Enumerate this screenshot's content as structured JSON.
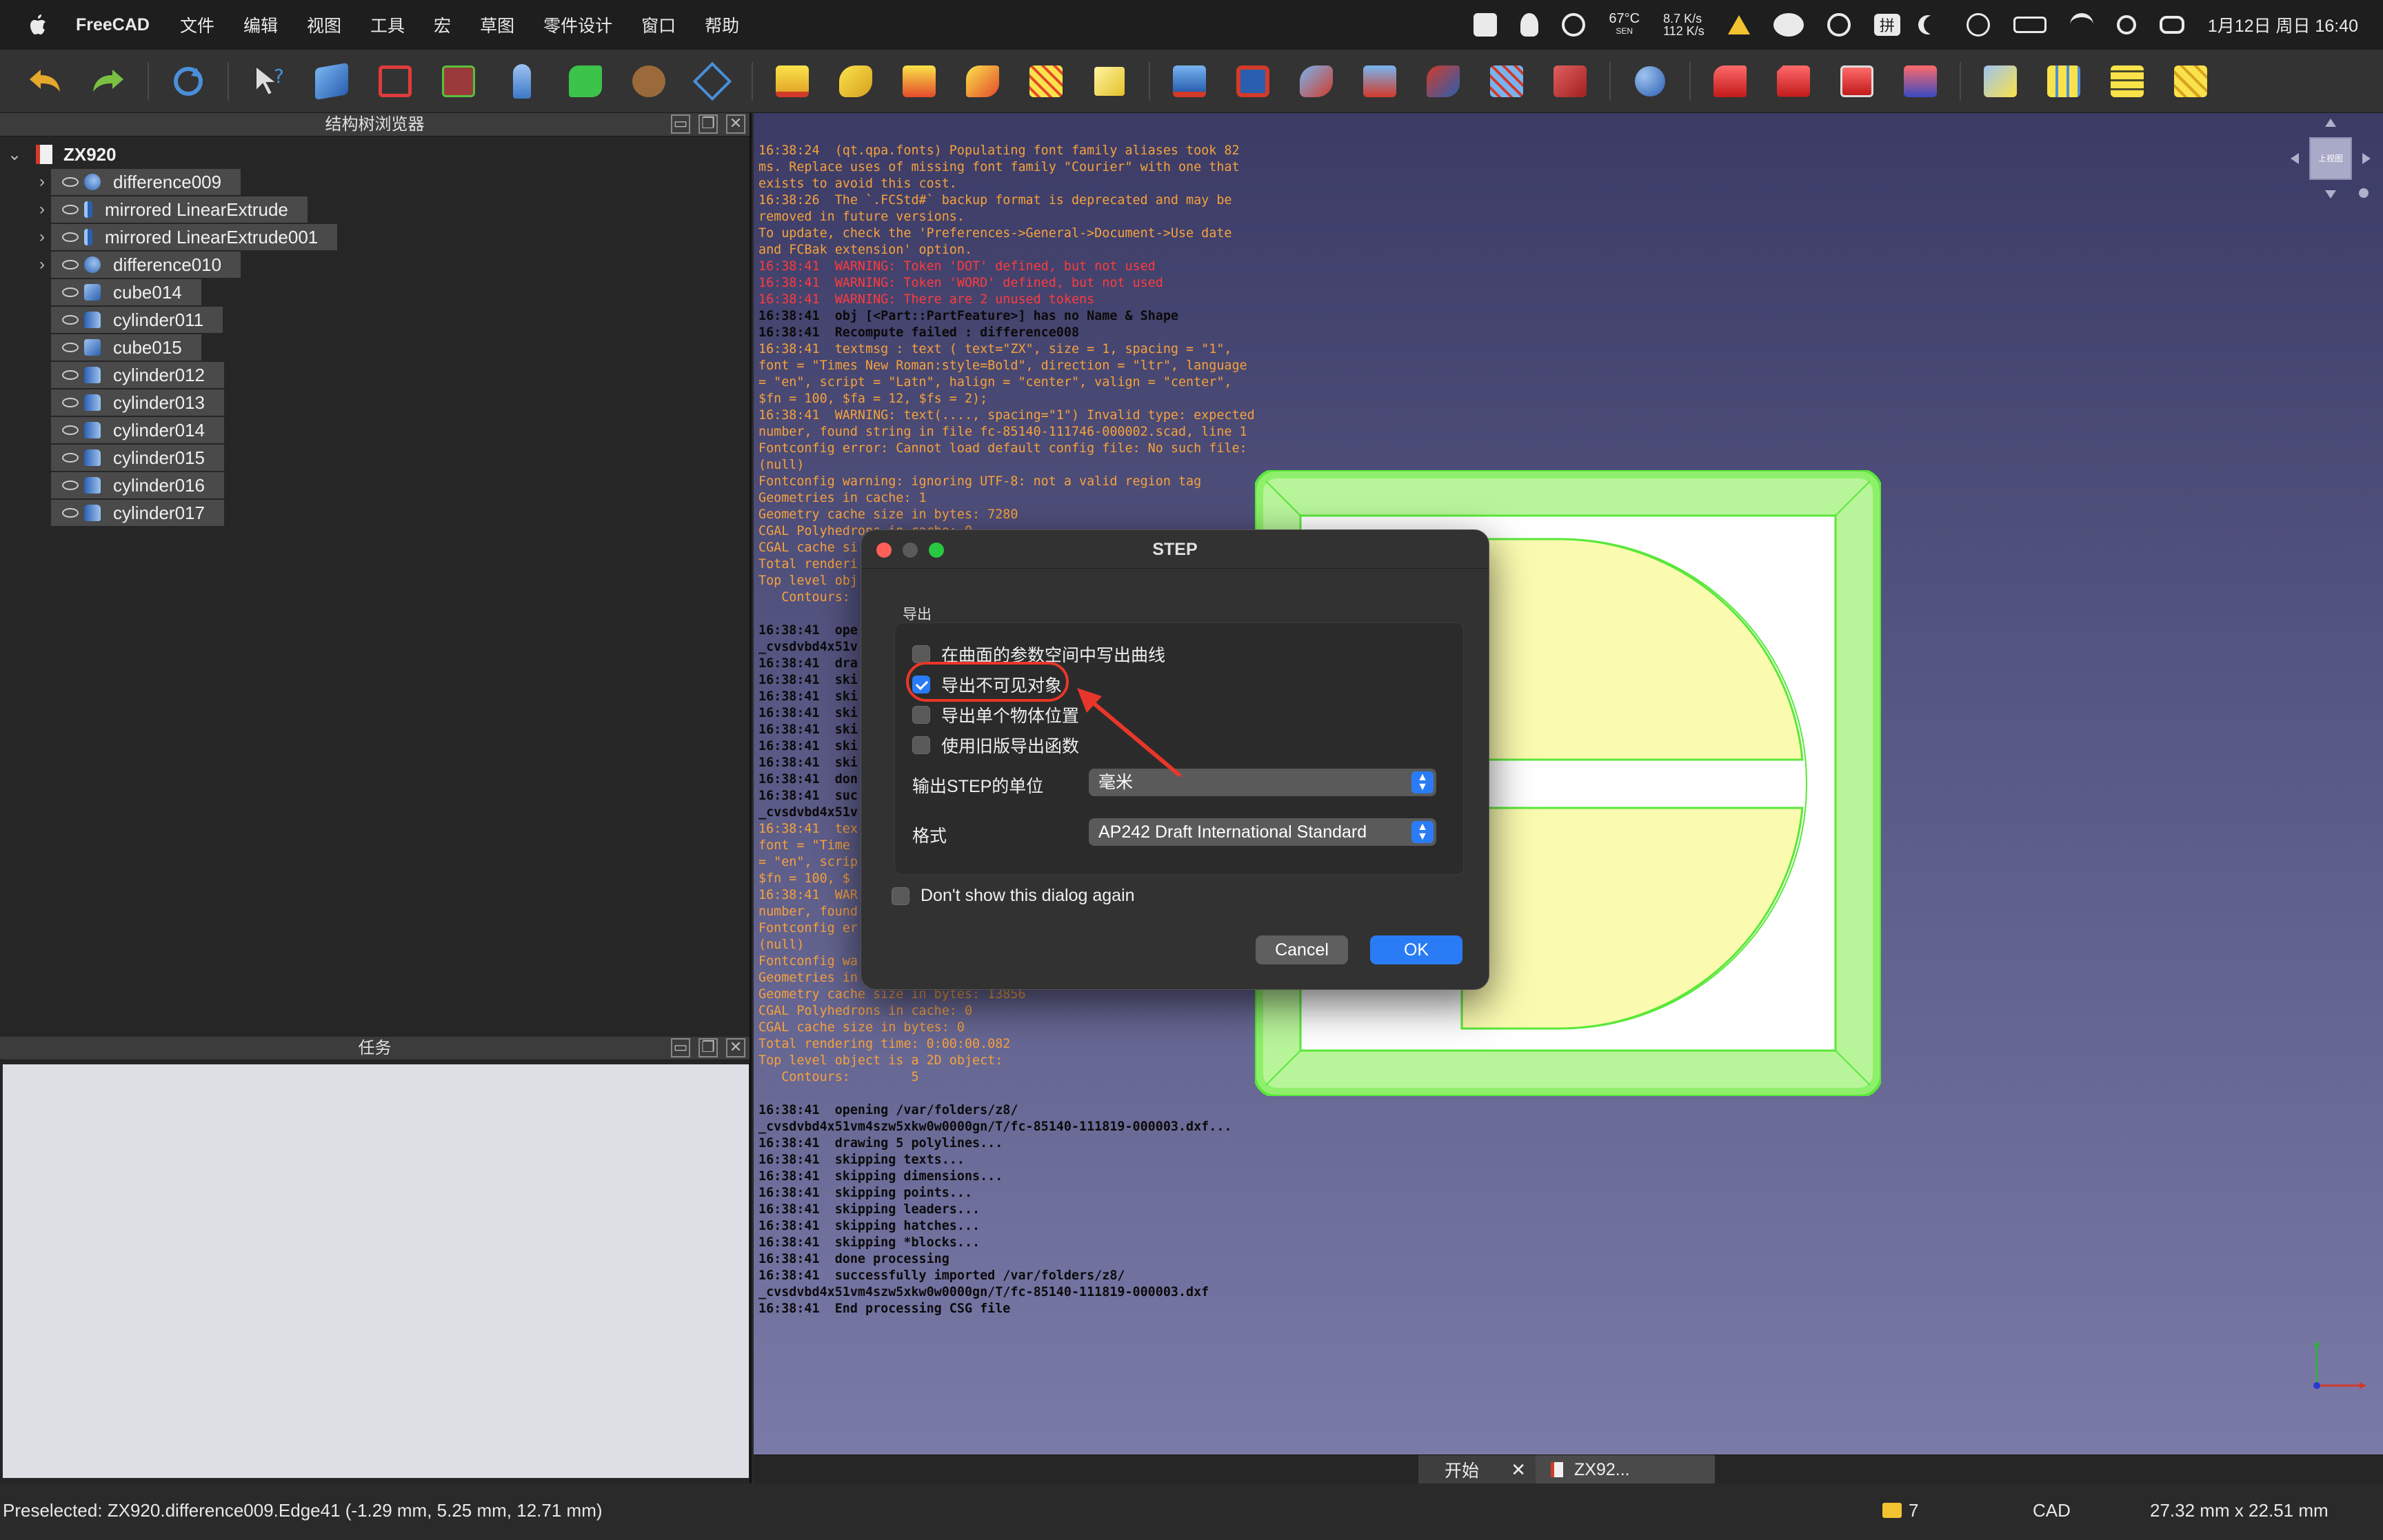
{
  "menubar": {
    "app_name": "FreeCAD",
    "menus": [
      "文件",
      "编辑",
      "视图",
      "工具",
      "宏",
      "草图",
      "零件设计",
      "窗口",
      "帮助"
    ],
    "temp": "67°C",
    "temp_sub": "SEN",
    "net_up": "8.7 K/s",
    "net_down": "112 K/s",
    "input_method": "拼",
    "datetime": "1月12日 周日 16:40"
  },
  "tree_panel": {
    "title": "结构树浏览器",
    "document": "ZX920",
    "items": [
      {
        "label": "difference009",
        "icon": "difference-icon",
        "expandable": true
      },
      {
        "label": "mirrored LinearExtrude",
        "icon": "extrude-icon",
        "expandable": true
      },
      {
        "label": "mirrored LinearExtrude001",
        "icon": "extrude-icon",
        "expandable": true
      },
      {
        "label": "difference010",
        "icon": "difference-icon",
        "expandable": true
      },
      {
        "label": "cube014",
        "icon": "cube-icon",
        "expandable": false
      },
      {
        "label": "cylinder011",
        "icon": "cylinder-icon",
        "expandable": false
      },
      {
        "label": "cube015",
        "icon": "cube-icon",
        "expandable": false
      },
      {
        "label": "cylinder012",
        "icon": "cylinder-icon",
        "expandable": false
      },
      {
        "label": "cylinder013",
        "icon": "cylinder-icon",
        "expandable": false
      },
      {
        "label": "cylinder014",
        "icon": "cylinder-icon",
        "expandable": false
      },
      {
        "label": "cylinder015",
        "icon": "cylinder-icon",
        "expandable": false
      },
      {
        "label": "cylinder016",
        "icon": "cylinder-icon",
        "expandable": false
      },
      {
        "label": "cylinder017",
        "icon": "cylinder-icon",
        "expandable": false
      }
    ]
  },
  "task_panel": {
    "title": "任务"
  },
  "console": {
    "lines": [
      {
        "t": "16:38:24  (qt.qpa.fonts) Populating font family aliases took 82",
        "c": "orange"
      },
      {
        "t": "ms. Replace uses of missing font family \"Courier\" with one that",
        "c": "orange"
      },
      {
        "t": "exists to avoid this cost.",
        "c": "orange"
      },
      {
        "t": "16:38:26  The `.FCStd#` backup format is deprecated and may be",
        "c": "orange"
      },
      {
        "t": "removed in future versions.",
        "c": "orange"
      },
      {
        "t": "To update, check the 'Preferences->General->Document->Use date",
        "c": "orange"
      },
      {
        "t": "and FCBak extension' option.",
        "c": "orange"
      },
      {
        "t": "16:38:41  WARNING: Token 'DOT' defined, but not used",
        "c": "red"
      },
      {
        "t": "16:38:41  WARNING: Token 'WORD' defined, but not used",
        "c": "red"
      },
      {
        "t": "16:38:41  WARNING: There are 2 unused tokens",
        "c": "red"
      },
      {
        "t": "16:38:41  obj [<Part::PartFeature>] has no Name & Shape",
        "c": "black"
      },
      {
        "t": "16:38:41  Recompute failed : difference008",
        "c": "black"
      },
      {
        "t": "16:38:41  textmsg : text ( text=\"ZX\", size = 1, spacing = \"1\",",
        "c": "orange"
      },
      {
        "t": "font = \"Times New Roman:style=Bold\", direction = \"ltr\", language",
        "c": "orange"
      },
      {
        "t": "= \"en\", script = \"Latn\", halign = \"center\", valign = \"center\",",
        "c": "orange"
      },
      {
        "t": "$fn = 100, $fa = 12, $fs = 2);",
        "c": "orange"
      },
      {
        "t": "16:38:41  WARNING: text(...., spacing=\"1\") Invalid type: expected",
        "c": "orange"
      },
      {
        "t": "number, found string in file fc-85140-111746-000002.scad, line 1",
        "c": "orange"
      },
      {
        "t": "Fontconfig error: Cannot load default config file: No such file:",
        "c": "orange"
      },
      {
        "t": "(null)",
        "c": "orange"
      },
      {
        "t": "Fontconfig warning: ignoring UTF-8: not a valid region tag",
        "c": "orange"
      },
      {
        "t": "Geometries in cache: 1",
        "c": "orange"
      },
      {
        "t": "Geometry cache size in bytes: 7280",
        "c": "orange"
      },
      {
        "t": "CGAL Polyhedrons in cache: 0",
        "c": "orange"
      },
      {
        "t": "CGAL cache si",
        "c": "orange"
      },
      {
        "t": "Total renderi",
        "c": "orange"
      },
      {
        "t": "Top level obj",
        "c": "orange"
      },
      {
        "t": "   Contours:",
        "c": "orange"
      },
      {
        "t": "",
        "c": "orange"
      },
      {
        "t": "16:38:41  ope",
        "c": "black"
      },
      {
        "t": "_cvsdvbd4x51v",
        "c": "black"
      },
      {
        "t": "16:38:41  dra",
        "c": "black"
      },
      {
        "t": "16:38:41  ski",
        "c": "black"
      },
      {
        "t": "16:38:41  ski",
        "c": "black"
      },
      {
        "t": "16:38:41  ski",
        "c": "black"
      },
      {
        "t": "16:38:41  ski",
        "c": "black"
      },
      {
        "t": "16:38:41  ski",
        "c": "black"
      },
      {
        "t": "16:38:41  ski",
        "c": "black"
      },
      {
        "t": "16:38:41  don",
        "c": "black"
      },
      {
        "t": "16:38:41  suc",
        "c": "black"
      },
      {
        "t": "_cvsdvbd4x51v",
        "c": "black"
      },
      {
        "t": "16:38:41  tex",
        "c": "orange"
      },
      {
        "t": "font = \"Time",
        "c": "orange"
      },
      {
        "t": "= \"en\", scrip",
        "c": "orange"
      },
      {
        "t": "$fn = 100, $",
        "c": "orange"
      },
      {
        "t": "16:38:41  WAR",
        "c": "orange"
      },
      {
        "t": "number, found",
        "c": "orange"
      },
      {
        "t": "Fontconfig er",
        "c": "orange"
      },
      {
        "t": "(null)",
        "c": "orange"
      },
      {
        "t": "Fontconfig wa",
        "c": "orange"
      },
      {
        "t": "Geometries in",
        "c": "orange"
      },
      {
        "t": "Geometry cache size in bytes: 13856",
        "c": "orange"
      },
      {
        "t": "CGAL Polyhedrons in cache: 0",
        "c": "orange"
      },
      {
        "t": "CGAL cache size in bytes: 0",
        "c": "orange"
      },
      {
        "t": "Total rendering time: 0:00:00.082",
        "c": "orange"
      },
      {
        "t": "Top level object is a 2D object:",
        "c": "orange"
      },
      {
        "t": "   Contours:        5",
        "c": "orange"
      },
      {
        "t": "",
        "c": "orange"
      },
      {
        "t": "16:38:41  opening /var/folders/z8/",
        "c": "black"
      },
      {
        "t": "_cvsdvbd4x51vm4szw5xkw0w0000gn/T/fc-85140-111819-000003.dxf...",
        "c": "black"
      },
      {
        "t": "16:38:41  drawing 5 polylines...",
        "c": "black"
      },
      {
        "t": "16:38:41  skipping texts...",
        "c": "black"
      },
      {
        "t": "16:38:41  skipping dimensions...",
        "c": "black"
      },
      {
        "t": "16:38:41  skipping points...",
        "c": "black"
      },
      {
        "t": "16:38:41  skipping leaders...",
        "c": "black"
      },
      {
        "t": "16:38:41  skipping hatches...",
        "c": "black"
      },
      {
        "t": "16:38:41  skipping *blocks...",
        "c": "black"
      },
      {
        "t": "16:38:41  done processing",
        "c": "black"
      },
      {
        "t": "16:38:41  successfully imported /var/folders/z8/",
        "c": "black"
      },
      {
        "t": "_cvsdvbd4x51vm4szw5xkw0w0000gn/T/fc-85140-111819-000003.dxf",
        "c": "black"
      },
      {
        "t": "16:38:41  End processing CSG file",
        "c": "black"
      }
    ]
  },
  "navcube": {
    "face_label": "上视图"
  },
  "dialog": {
    "title": "STEP",
    "group_label": "导出",
    "options": [
      {
        "label": "在曲面的参数空间中写出曲线",
        "checked": false
      },
      {
        "label": "导出不可见对象",
        "checked": true
      },
      {
        "label": "导出单个物体位置",
        "checked": false
      },
      {
        "label": "使用旧版导出函数",
        "checked": false
      }
    ],
    "unit_label": "输出STEP的单位",
    "unit_value": "毫米",
    "format_label": "格式",
    "format_value": "AP242 Draft International Standard",
    "dont_show_label": "Don't show this dialog again",
    "cancel_label": "Cancel",
    "ok_label": "OK",
    "accent_color": "#2a7cf6"
  },
  "doc_tabs": [
    {
      "label": "开始"
    },
    {
      "label": "ZX92..."
    }
  ],
  "statusbar": {
    "message": "Preselected: ZX920.difference009.Edge41 (-1.29 mm, 5.25 mm, 12.71 mm)",
    "count": "7",
    "nav_style": "CAD",
    "dimensions": "27.32 mm x 22.51 mm"
  },
  "annotation_color": "#e8372a"
}
